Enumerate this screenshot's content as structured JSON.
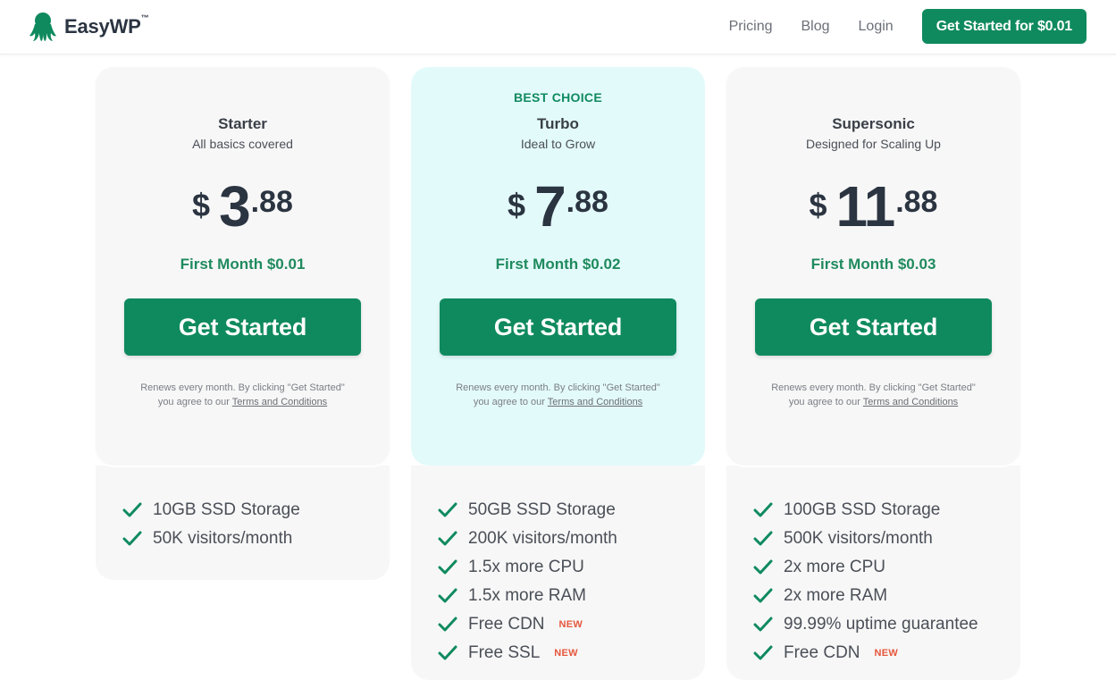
{
  "header": {
    "brand": "EasyWP",
    "brand_tm": "™",
    "nav": [
      {
        "label": "Pricing"
      },
      {
        "label": "Blog"
      },
      {
        "label": "Login"
      }
    ],
    "cta_label": "Get Started for $0.01"
  },
  "plans": [
    {
      "badge": "",
      "name": "Starter",
      "subtitle": "All basics covered",
      "currency": "$",
      "price_int": "3",
      "price_dec": ".88",
      "first_month": "First Month $0.01",
      "cta_label": "Get Started",
      "terms_line1": "Renews every month. By clicking \"Get Started\"",
      "terms_prefix": "you agree to our",
      "terms_link": "Terms and Conditions",
      "features": [
        {
          "label": "10GB SSD Storage",
          "badge": ""
        },
        {
          "label": "50K visitors/month",
          "badge": ""
        }
      ]
    },
    {
      "badge": "BEST CHOICE",
      "name": "Turbo",
      "subtitle": "Ideal to Grow",
      "currency": "$",
      "price_int": "7",
      "price_dec": ".88",
      "first_month": "First Month $0.02",
      "cta_label": "Get Started",
      "terms_line1": "Renews every month. By clicking \"Get Started\"",
      "terms_prefix": "you agree to our",
      "terms_link": "Terms and Conditions",
      "features": [
        {
          "label": "50GB SSD Storage",
          "badge": ""
        },
        {
          "label": "200K visitors/month",
          "badge": ""
        },
        {
          "label": "1.5x more CPU",
          "badge": ""
        },
        {
          "label": "1.5x more RAM",
          "badge": ""
        },
        {
          "label": "Free CDN",
          "badge": "NEW"
        },
        {
          "label": "Free SSL",
          "badge": "NEW"
        }
      ]
    },
    {
      "badge": "",
      "name": "Supersonic",
      "subtitle": "Designed for Scaling Up",
      "currency": "$",
      "price_int": "11",
      "price_dec": ".88",
      "first_month": "First Month $0.03",
      "cta_label": "Get Started",
      "terms_line1": "Renews every month. By clicking \"Get Started\"",
      "terms_prefix": "you agree to our",
      "terms_link": "Terms and Conditions",
      "features": [
        {
          "label": "100GB SSD Storage",
          "badge": ""
        },
        {
          "label": "500K visitors/month",
          "badge": ""
        },
        {
          "label": "2x more CPU",
          "badge": ""
        },
        {
          "label": "2x more RAM",
          "badge": ""
        },
        {
          "label": "99.99% uptime guarantee",
          "badge": ""
        },
        {
          "label": "Free CDN",
          "badge": "NEW"
        }
      ]
    }
  ],
  "icons": {
    "logo": "octopus-logo-icon",
    "check": "check-icon"
  },
  "colors": {
    "brand_green": "#0f8a5f",
    "highlight_card": "#e3fafa",
    "new_badge": "#e5573d"
  }
}
